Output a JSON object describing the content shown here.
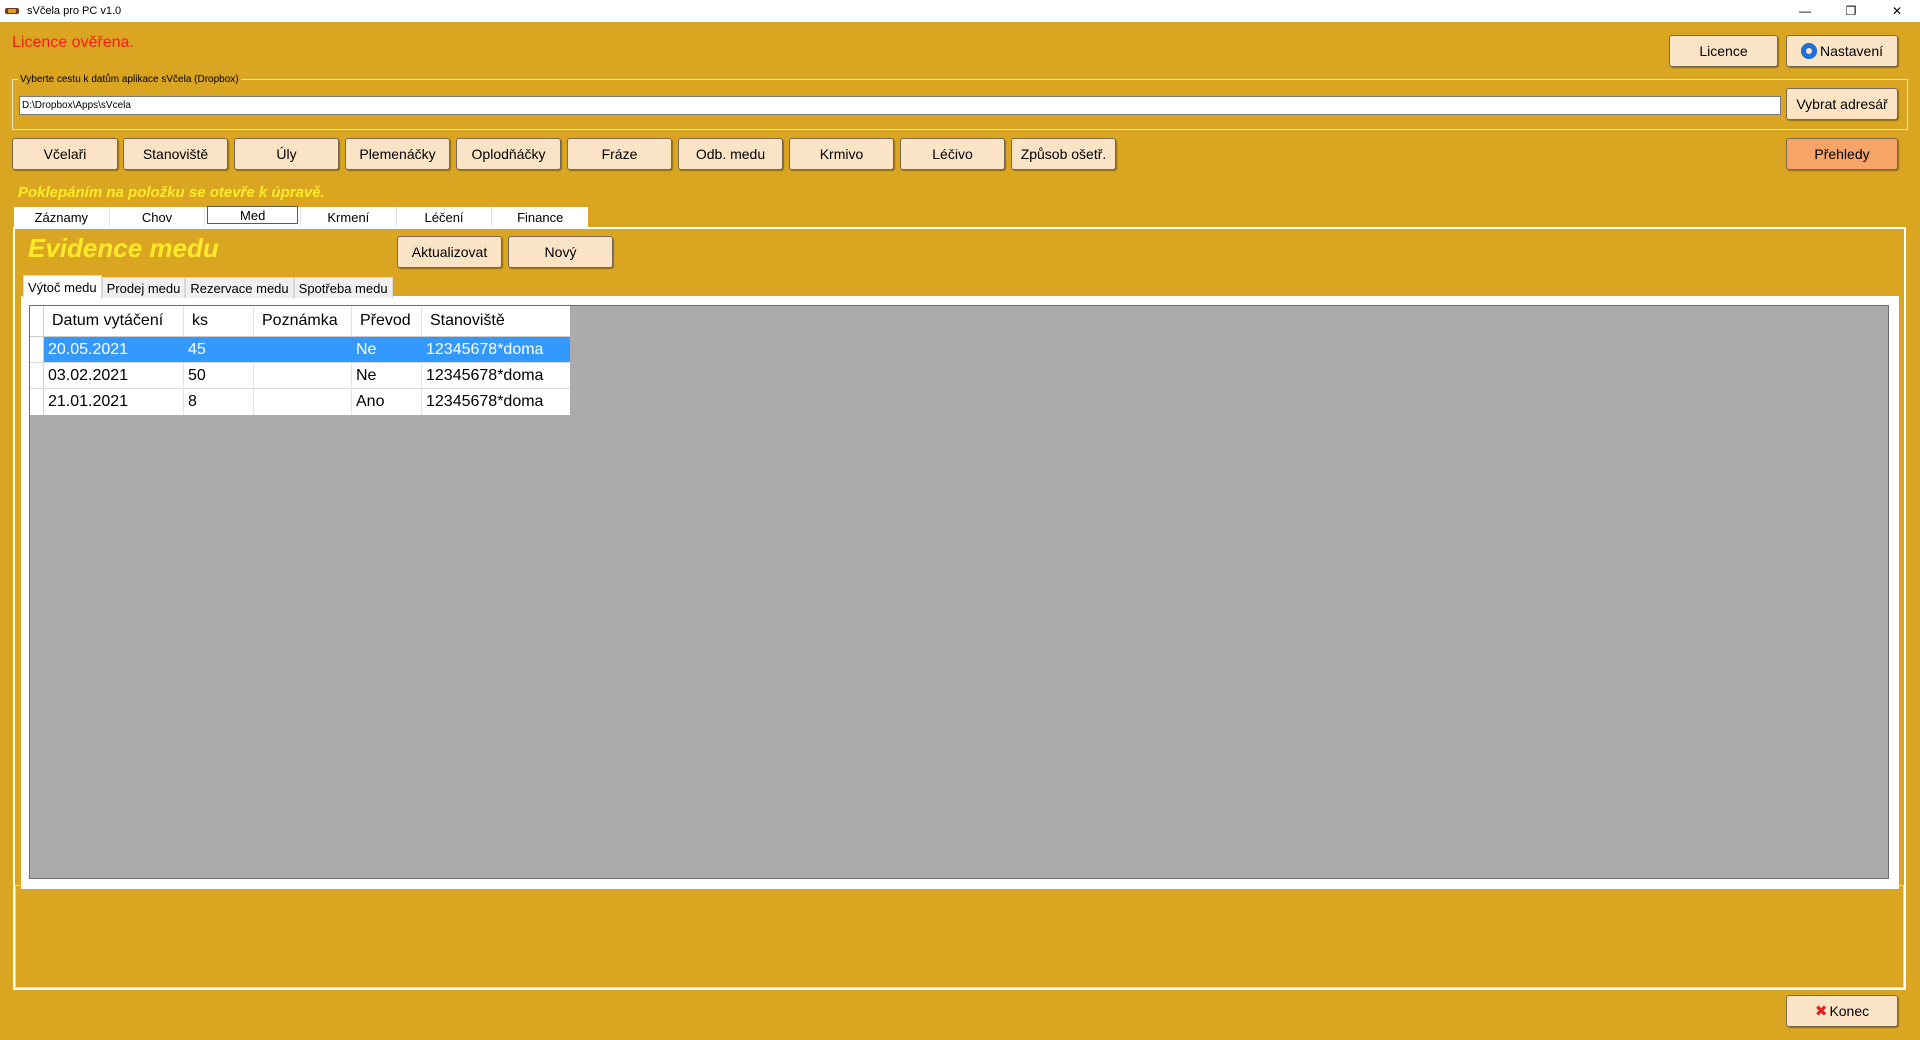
{
  "window": {
    "title": "sVčela pro PC v1.0",
    "minimize": "—",
    "restore": "❐",
    "close": "✕"
  },
  "license_status": "Licence ověřena.",
  "header_buttons": {
    "licence": "Licence",
    "nastaveni": "Nastavení"
  },
  "path": {
    "label": "Vyberte cestu k datům aplikace sVčela (Dropbox)",
    "value": "D:\\Dropbox\\Apps\\sVcela",
    "choose_button": "Vybrat adresář"
  },
  "nav_buttons": [
    "Včelaři",
    "Stanoviště",
    "Úly",
    "Plemenáčky",
    "Oplodňáčky",
    "Fráze",
    "Odb. medu",
    "Krmivo",
    "Léčivo",
    "Způsob ošetř."
  ],
  "overview_button": "Přehledy",
  "hint": "Poklepáním na položku se otevře k úpravě.",
  "top_tabs": [
    "Záznamy",
    "Chov",
    "Med",
    "Krmení",
    "Léčení",
    "Finance"
  ],
  "section": {
    "title": "Evidence medu",
    "refresh_button": "Aktualizovat",
    "new_button": "Nový"
  },
  "inner_tabs": [
    "Výtoč medu",
    "Prodej medu",
    "Rezervace medu",
    "Spotřeba medu"
  ],
  "table": {
    "columns": [
      "Datum vytáčení",
      "ks",
      "Poznámka",
      "Převod",
      "Stanoviště"
    ],
    "rows": [
      [
        "20.05.2021",
        "45",
        "",
        "Ne",
        "12345678*doma"
      ],
      [
        "03.02.2021",
        "50",
        "",
        "Ne",
        "12345678*doma"
      ],
      [
        "21.01.2021",
        "8",
        "",
        "Ano",
        "12345678*doma"
      ]
    ]
  },
  "exit_button": "Konec",
  "colors": {
    "background": "#DAA520",
    "button": "#FBE4C6",
    "overview_button": "#F6A468",
    "license_text": "#FF1A1A",
    "highlight_text": "#FFEA2A",
    "selection": "#3399FF"
  }
}
